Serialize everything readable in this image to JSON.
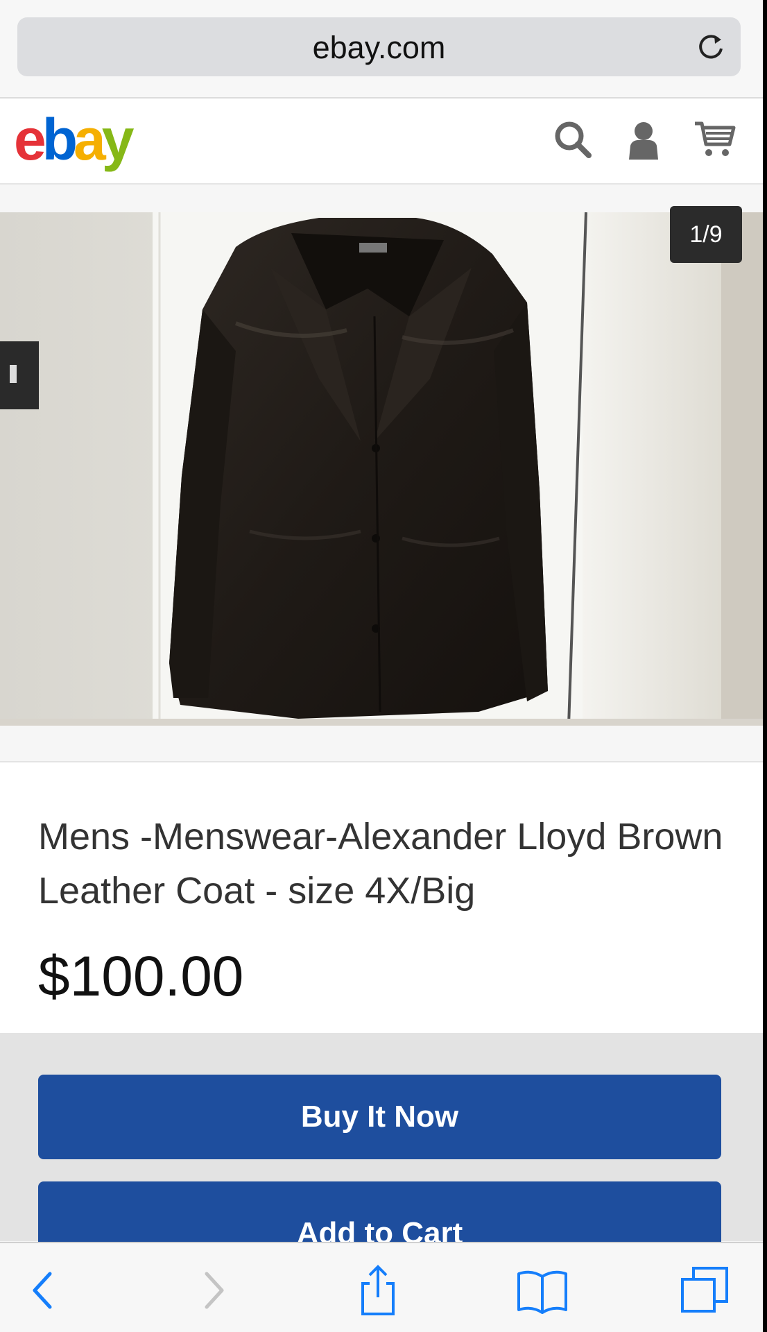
{
  "browser": {
    "url": "ebay.com",
    "icons": [
      "reload-icon",
      "back-icon",
      "forward-icon",
      "share-icon",
      "bookmarks-icon",
      "tabs-icon"
    ]
  },
  "header": {
    "logo_letters": [
      "e",
      "b",
      "a",
      "y"
    ],
    "logo_colors": [
      "#e53238",
      "#0064d2",
      "#f5af02",
      "#86b817"
    ],
    "icons": [
      "search-icon",
      "account-icon",
      "cart-icon"
    ]
  },
  "gallery": {
    "counter": "1/9"
  },
  "item": {
    "title": "Mens -Menswear-Alexander Lloyd Brown Leather Coat - size 4X/Big",
    "price": "$100.00"
  },
  "actions": {
    "buy_now": "Buy It Now",
    "add_to_cart": "Add to Cart"
  },
  "colors": {
    "button": "#1e4e9e",
    "accent_icon": "#157efb"
  }
}
